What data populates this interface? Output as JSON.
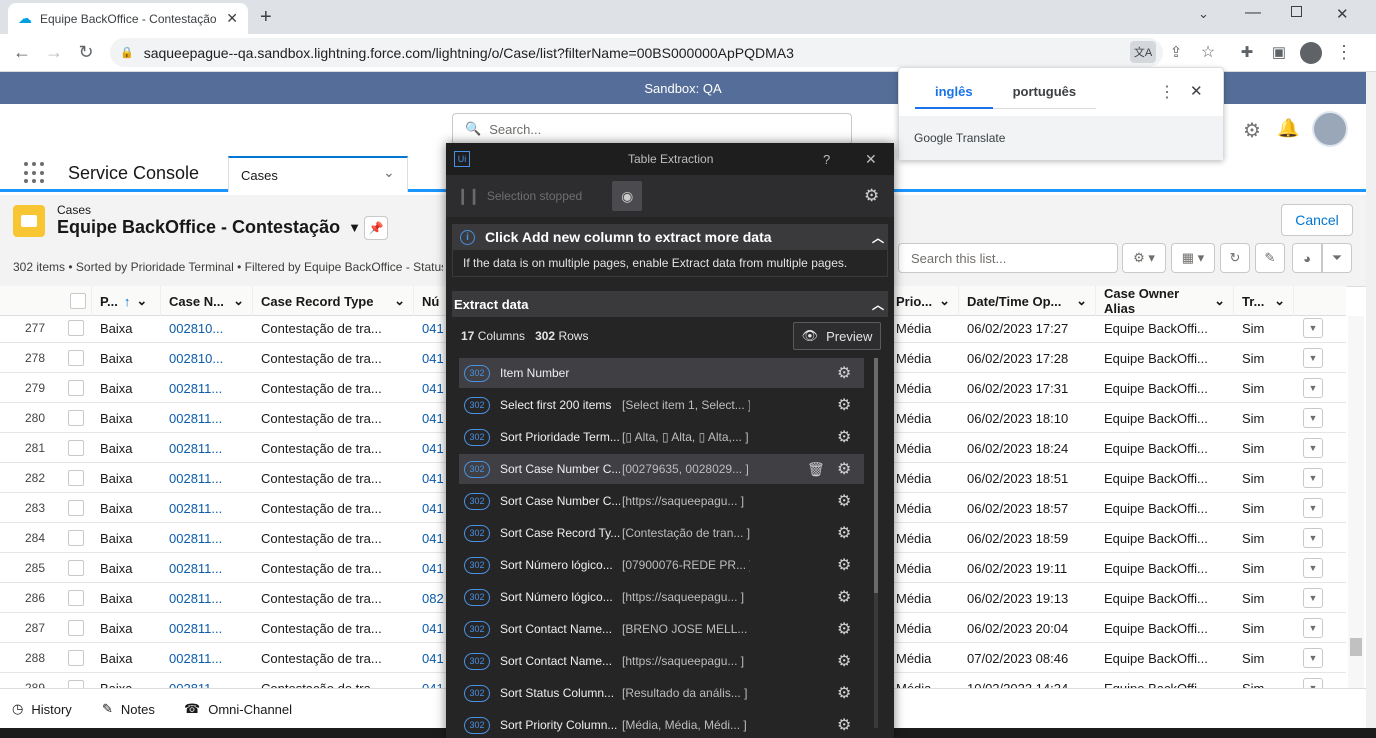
{
  "browser": {
    "tab_title": "Equipe BackOffice - Contestação",
    "url": "saqueepague--qa.sandbox.lightning.force.com/lightning/o/Case/list?filterName=00BS000000ApPQDMA3"
  },
  "sandbox_banner": "Sandbox: QA",
  "header": {
    "search_placeholder": "Search..."
  },
  "nav": {
    "app_name": "Service Console",
    "tab_label": "Cases"
  },
  "list": {
    "object_label": "Cases",
    "title": "Equipe BackOffice - Contestação",
    "cancel_label": "Cancel",
    "meta": "302 items • Sorted by Prioridade Terminal • Filtered by Equipe BackOffice - Status,",
    "search_placeholder": "Search this list..."
  },
  "columns": {
    "prioridade": "P...",
    "case_number": "Case N...",
    "record_type": "Case Record Type",
    "numero": "Nú",
    "priority": "Prio...",
    "datetime": "Date/Time Op...",
    "owner": "Case Owner Alias",
    "tr": "Tr..."
  },
  "rows": [
    {
      "n": "277",
      "p": "Baixa",
      "c": "002810...",
      "r": "Contestação de tra...",
      "num": "041",
      "pr": "Média",
      "d": "06/02/2023 17:27",
      "o": "Equipe BackOffi...",
      "t": "Sim"
    },
    {
      "n": "278",
      "p": "Baixa",
      "c": "002810...",
      "r": "Contestação de tra...",
      "num": "041",
      "pr": "Média",
      "d": "06/02/2023 17:28",
      "o": "Equipe BackOffi...",
      "t": "Sim"
    },
    {
      "n": "279",
      "p": "Baixa",
      "c": "002811...",
      "r": "Contestação de tra...",
      "num": "041",
      "pr": "Média",
      "d": "06/02/2023 17:31",
      "o": "Equipe BackOffi...",
      "t": "Sim"
    },
    {
      "n": "280",
      "p": "Baixa",
      "c": "002811...",
      "r": "Contestação de tra...",
      "num": "041",
      "pr": "Média",
      "d": "06/02/2023 18:10",
      "o": "Equipe BackOffi...",
      "t": "Sim"
    },
    {
      "n": "281",
      "p": "Baixa",
      "c": "002811...",
      "r": "Contestação de tra...",
      "num": "041",
      "pr": "Média",
      "d": "06/02/2023 18:24",
      "o": "Equipe BackOffi...",
      "t": "Sim"
    },
    {
      "n": "282",
      "p": "Baixa",
      "c": "002811...",
      "r": "Contestação de tra...",
      "num": "041",
      "pr": "Média",
      "d": "06/02/2023 18:51",
      "o": "Equipe BackOffi...",
      "t": "Sim"
    },
    {
      "n": "283",
      "p": "Baixa",
      "c": "002811...",
      "r": "Contestação de tra...",
      "num": "041",
      "pr": "Média",
      "d": "06/02/2023 18:57",
      "o": "Equipe BackOffi...",
      "t": "Sim"
    },
    {
      "n": "284",
      "p": "Baixa",
      "c": "002811...",
      "r": "Contestação de tra...",
      "num": "041",
      "pr": "Média",
      "d": "06/02/2023 18:59",
      "o": "Equipe BackOffi...",
      "t": "Sim"
    },
    {
      "n": "285",
      "p": "Baixa",
      "c": "002811...",
      "r": "Contestação de tra...",
      "num": "041",
      "pr": "Média",
      "d": "06/02/2023 19:11",
      "o": "Equipe BackOffi...",
      "t": "Sim"
    },
    {
      "n": "286",
      "p": "Baixa",
      "c": "002811...",
      "r": "Contestação de tra...",
      "num": "082",
      "pr": "Média",
      "d": "06/02/2023 19:13",
      "o": "Equipe BackOffi...",
      "t": "Sim"
    },
    {
      "n": "287",
      "p": "Baixa",
      "c": "002811...",
      "r": "Contestação de tra...",
      "num": "041",
      "pr": "Média",
      "d": "06/02/2023 20:04",
      "o": "Equipe BackOffi...",
      "t": "Sim"
    },
    {
      "n": "288",
      "p": "Baixa",
      "c": "002811...",
      "r": "Contestação de tra...",
      "num": "041",
      "pr": "Média",
      "d": "07/02/2023 08:46",
      "o": "Equipe BackOffi...",
      "t": "Sim"
    },
    {
      "n": "289",
      "p": "Baixa",
      "c": "002811...",
      "r": "Contestação de tra...",
      "num": "041",
      "pr": "Média",
      "d": "10/02/2023 14:24",
      "o": "Equipe BackOffi...",
      "t": "Sim"
    }
  ],
  "utility": {
    "history": "History",
    "notes": "Notes",
    "omni": "Omni-Channel"
  },
  "translate": {
    "lang_active": "inglês",
    "lang_other": "português",
    "footer": "Google Translate"
  },
  "panel": {
    "logo": "Ui",
    "title": "Table Extraction",
    "help": "?",
    "selection_status": "Selection stopped",
    "info_title": "Click Add new column to extract more data",
    "info_body": "If the data is on multiple pages, enable Extract data from multiple pages.",
    "extract_title": "Extract data",
    "columns_count": "17",
    "columns_label": "Columns",
    "rows_count": "302",
    "rows_label": "Rows",
    "preview_label": "Preview",
    "columns": [
      {
        "badge": "302",
        "name": "Item Number",
        "sample": ""
      },
      {
        "badge": "302",
        "name": "Select first 200 items",
        "sample": "[Select item 1, Select... ]"
      },
      {
        "badge": "302",
        "name": "Sort Prioridade Term...",
        "sample": "[▯ Alta, ▯ Alta, ▯ Alta,... ]"
      },
      {
        "badge": "302",
        "name": "Sort Case Number C...",
        "sample": "[00279635, 0028029... ]"
      },
      {
        "badge": "302",
        "name": "Sort Case Number C...",
        "sample": "[https://saqueepagu... ]"
      },
      {
        "badge": "302",
        "name": "Sort Case Record Ty...",
        "sample": "[Contestação de tran... ]"
      },
      {
        "badge": "302",
        "name": "Sort Número lógico...",
        "sample": "[07900076-REDE PR... ]"
      },
      {
        "badge": "302",
        "name": "Sort Número lógico...",
        "sample": "[https://saqueepagu... ]"
      },
      {
        "badge": "302",
        "name": "Sort Contact Name...",
        "sample": "[BRENO JOSE MELL... ]"
      },
      {
        "badge": "302",
        "name": "Sort Contact Name...",
        "sample": "[https://saqueepagu... ]"
      },
      {
        "badge": "302",
        "name": "Sort Status Column...",
        "sample": "[Resultado da anális... ]"
      },
      {
        "badge": "302",
        "name": "Sort Priority Column...",
        "sample": "[Média, Média, Médi... ]"
      }
    ]
  },
  "colors": {
    "sandbox": "#556d99",
    "accent": "#0176d3",
    "panel_bg": "#252526",
    "badge": "#4a90e2",
    "case_icon": "#f9c633"
  }
}
